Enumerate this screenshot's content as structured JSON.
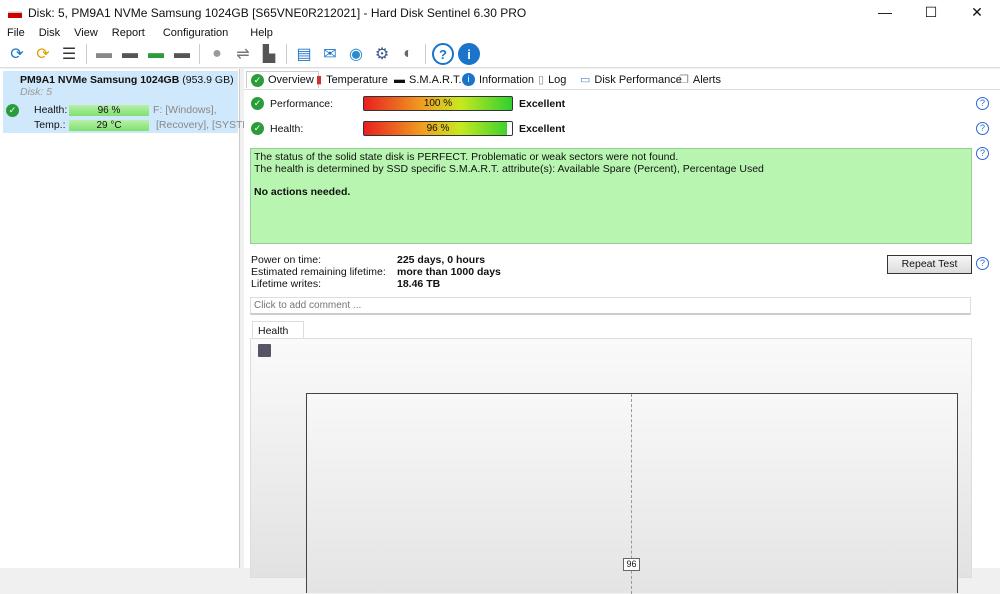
{
  "window": {
    "title": "Disk: 5, PM9A1 NVMe Samsung 1024GB [S65VNE0R212021]  -  Hard Disk Sentinel 6.30 PRO",
    "minimize": "—",
    "maximize": "☐",
    "close": "✕"
  },
  "menu": [
    "File",
    "Disk",
    "View",
    "Report",
    "Configuration",
    "Help"
  ],
  "toolbar": [
    {
      "icon": "refresh-icon",
      "g": "⟳",
      "c": "#1a74c9"
    },
    {
      "icon": "refresh-warning-icon",
      "g": "⟳",
      "c": "#e0a000"
    },
    {
      "icon": "disk-list-icon",
      "g": "☰",
      "c": "#333"
    },
    {
      "icon": "disk-surface-icon",
      "g": "▬",
      "c": "#888"
    },
    {
      "icon": "disk-schedule-icon",
      "g": "▬",
      "c": "#555"
    },
    {
      "icon": "disk-ok-icon",
      "g": "▬",
      "c": "#2a9d3a"
    },
    {
      "icon": "disk-search-icon",
      "g": "▬",
      "c": "#555"
    },
    {
      "icon": "disk-drive-icon",
      "g": "●",
      "c": "#999"
    },
    {
      "icon": "usb-icon",
      "g": "⇌",
      "c": "#777"
    },
    {
      "icon": "backup-icon",
      "g": "▙",
      "c": "#555"
    },
    {
      "icon": "report-icon",
      "g": "▤",
      "c": "#1a74c9"
    },
    {
      "icon": "mail-icon",
      "g": "✉",
      "c": "#1a74c9"
    },
    {
      "icon": "network-icon",
      "g": "◉",
      "c": "#2a8ad0"
    },
    {
      "icon": "settings-icon",
      "g": "⚙",
      "c": "#3a5a8a"
    },
    {
      "icon": "sound-icon",
      "g": "◐",
      "c": "#666"
    },
    {
      "icon": "help-icon",
      "g": "?",
      "c": "#1a74c9"
    },
    {
      "icon": "info-icon",
      "g": "i",
      "c": "#1a74c9"
    }
  ],
  "disk": {
    "name": "PM9A1 NVMe Samsung 1024GB",
    "size": "(953.9 GB)",
    "disk_no": "Disk: 5",
    "health_label": "Health:",
    "health": "96 %",
    "temp_label": "Temp.:",
    "temp": "29 °C",
    "vol1": "F: [Windows],",
    "vol2": "[Recovery],  [SYSTEM"
  },
  "tabs": [
    "Overview",
    "Temperature",
    "S.M.A.R.T.",
    "Information",
    "Log",
    "Disk Performance",
    "Alerts"
  ],
  "overview": {
    "performance_label": "Performance:",
    "performance_value": "100 %",
    "performance_pct": 100,
    "performance_rating": "Excellent",
    "health_label": "Health:",
    "health_value": "96 %",
    "health_pct": 96,
    "health_rating": "Excellent",
    "status_line1": "The status of the solid state disk is PERFECT. Problematic or weak sectors were not found.",
    "status_line2": "The health is determined by SSD specific S.M.A.R.T. attribute(s):  Available Spare (Percent), Percentage Used",
    "status_action": "No actions needed.",
    "power_on_label": "Power on time:",
    "power_on": "225 days, 0 hours",
    "remaining_label": "Estimated remaining lifetime:",
    "remaining": "more than 1000 days",
    "writes_label": "Lifetime writes:",
    "writes": "18.46 TB",
    "repeat_test": "Repeat Test",
    "comment_placeholder": "Click to add comment ...",
    "help": "?"
  },
  "chart_data": {
    "type": "line",
    "title": "Health (%)",
    "series": [
      {
        "name": "Health",
        "values": [
          96
        ]
      }
    ],
    "labels": [
      "96"
    ]
  }
}
